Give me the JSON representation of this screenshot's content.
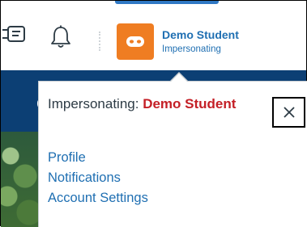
{
  "header": {
    "user_name": "Demo Student",
    "user_status": "Impersonating",
    "icons": [
      "doc-icon",
      "bell-icon",
      "avatar-mask-icon"
    ],
    "avatar_color": "#ef7d22",
    "accent_color": "#1f6fb2"
  },
  "background": {
    "partial_letter": "C"
  },
  "popover": {
    "impersonating_label": "Impersonating:",
    "impersonating_name": "Demo Student",
    "impersonating_name_color": "#c41f26",
    "close_glyph": "✕",
    "links": [
      {
        "label": "Profile"
      },
      {
        "label": "Notifications"
      },
      {
        "label": "Account Settings"
      }
    ]
  }
}
